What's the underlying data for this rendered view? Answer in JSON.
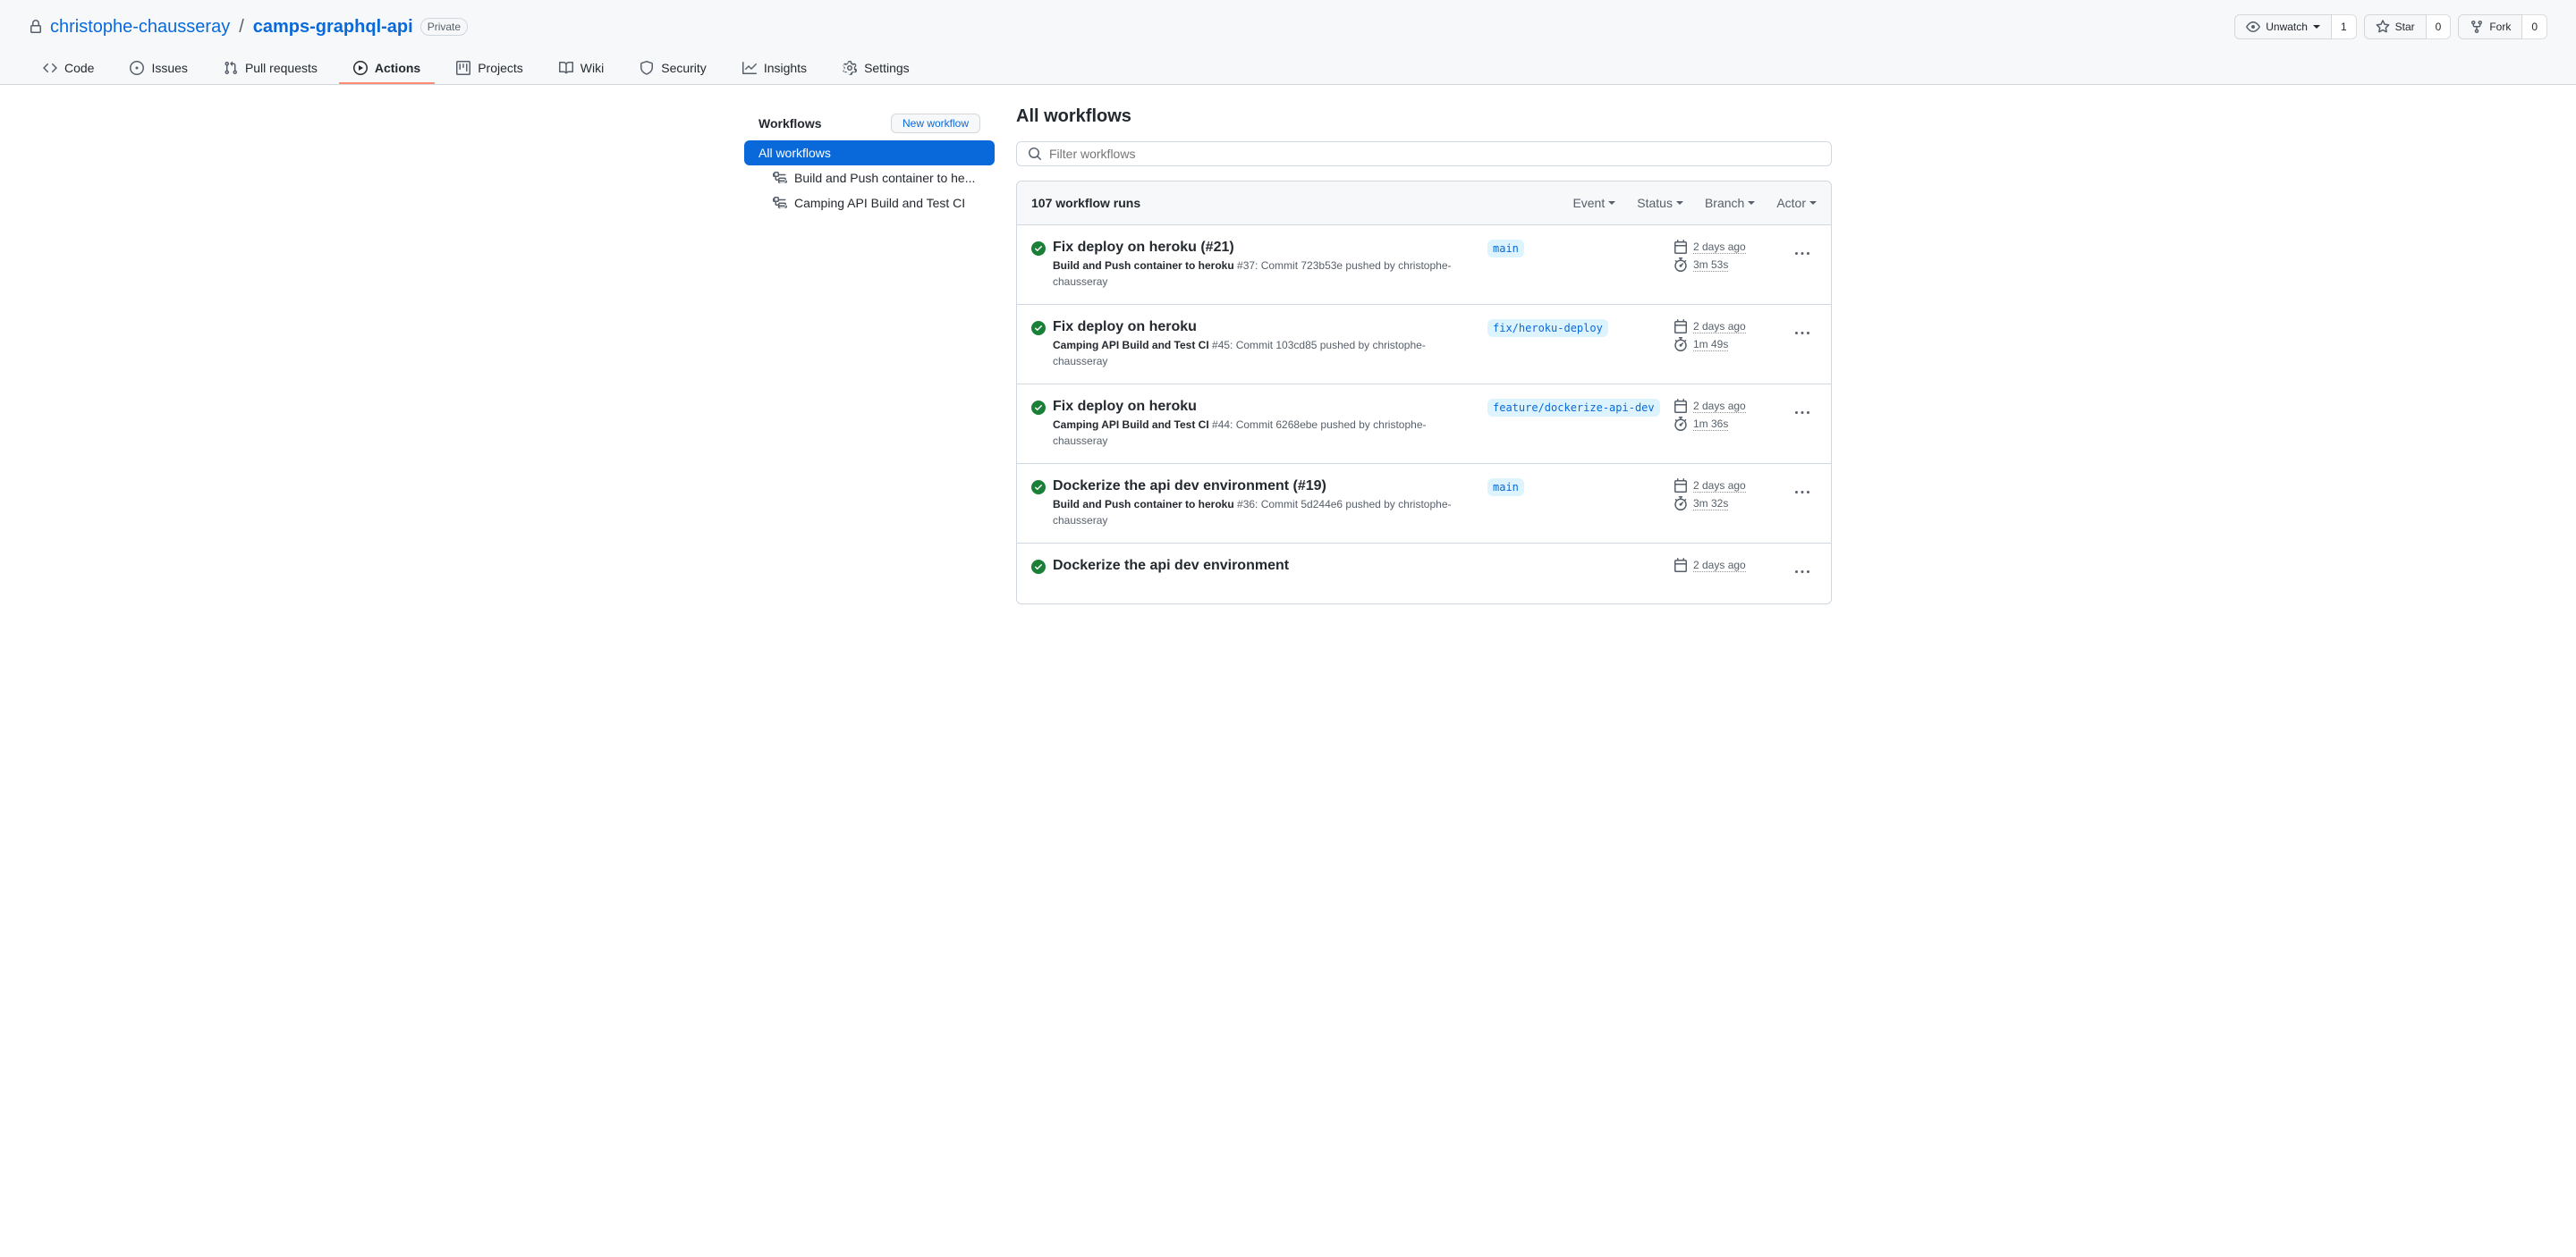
{
  "repo": {
    "owner": "christophe-chausseray",
    "name": "camps-graphql-api",
    "visibility": "Private"
  },
  "header_actions": {
    "unwatch": {
      "label": "Unwatch",
      "count": "1"
    },
    "star": {
      "label": "Star",
      "count": "0"
    },
    "fork": {
      "label": "Fork",
      "count": "0"
    }
  },
  "nav": {
    "code": "Code",
    "issues": "Issues",
    "pulls": "Pull requests",
    "actions": "Actions",
    "projects": "Projects",
    "wiki": "Wiki",
    "security": "Security",
    "insights": "Insights",
    "settings": "Settings"
  },
  "sidebar": {
    "title": "Workflows",
    "new_workflow": "New workflow",
    "all_workflows": "All workflows",
    "items": [
      "Build and Push container to he...",
      "Camping API Build and Test CI"
    ]
  },
  "main": {
    "title": "All workflows",
    "filter_placeholder": "Filter workflows",
    "runs_count": "107 workflow runs",
    "filters": {
      "event": "Event",
      "status": "Status",
      "branch": "Branch",
      "actor": "Actor"
    },
    "runs": [
      {
        "title": "Fix deploy on heroku (#21)",
        "workflow": "Build and Push container to heroku",
        "run_num": "#37",
        "commit": "723b53e",
        "pusher": "christophe-chausseray",
        "branch": "main",
        "time": "2 days ago",
        "duration": "3m 53s"
      },
      {
        "title": "Fix deploy on heroku",
        "workflow": "Camping API Build and Test CI",
        "run_num": "#45",
        "commit": "103cd85",
        "pusher": "christophe-chausseray",
        "branch": "fix/heroku-deploy",
        "time": "2 days ago",
        "duration": "1m 49s"
      },
      {
        "title": "Fix deploy on heroku",
        "workflow": "Camping API Build and Test CI",
        "run_num": "#44",
        "commit": "6268ebe",
        "pusher": "christophe-chausseray",
        "branch": "feature/dockerize-api-dev",
        "time": "2 days ago",
        "duration": "1m 36s"
      },
      {
        "title": "Dockerize the api dev environment (#19)",
        "workflow": "Build and Push container to heroku",
        "run_num": "#36",
        "commit": "5d244e6",
        "pusher": "christophe-chausseray",
        "branch": "main",
        "time": "2 days ago",
        "duration": "3m 32s"
      },
      {
        "title": "Dockerize the api dev environment",
        "workflow": "",
        "run_num": "",
        "commit": "",
        "pusher": "",
        "branch": "",
        "time": "2 days ago",
        "duration": ""
      }
    ]
  }
}
